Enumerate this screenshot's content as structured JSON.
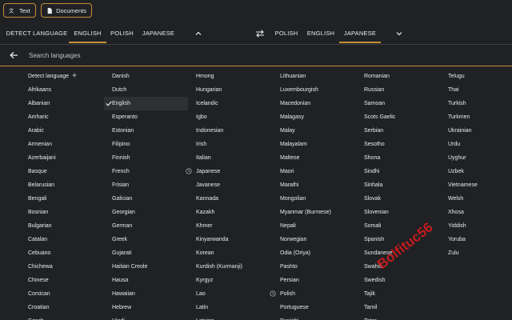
{
  "top_buttons": {
    "text": "Text",
    "documents": "Documents"
  },
  "source_tabs": [
    "DETECT LANGUAGE",
    "ENGLISH",
    "POLISH",
    "JAPANESE"
  ],
  "target_tabs": [
    "POLISH",
    "ENGLISH",
    "JAPANESE"
  ],
  "search": {
    "placeholder": "Search languages"
  },
  "columns": [
    [
      "Detect language",
      "Afrikaans",
      "Albanian",
      "Amharic",
      "Arabic",
      "Armenian",
      "Azerbaijani",
      "Basque",
      "Belarusian",
      "Bengali",
      "Bosnian",
      "Bulgarian",
      "Catalan",
      "Cebuano",
      "Chichewa",
      "Chinese",
      "Corsican",
      "Croatian",
      "Czech"
    ],
    [
      "Danish",
      "Dutch",
      "English",
      "Esperanto",
      "Estonian",
      "Filipino",
      "Finnish",
      "French",
      "Frisian",
      "Galician",
      "Georgian",
      "German",
      "Greek",
      "Gujarati",
      "Haitian Creole",
      "Hausa",
      "Hawaiian",
      "Hebrew",
      "Hindi"
    ],
    [
      "Hmong",
      "Hungarian",
      "Icelandic",
      "Igbo",
      "Indonesian",
      "Irish",
      "Italian",
      "Japanese",
      "Javanese",
      "Kannada",
      "Kazakh",
      "Khmer",
      "Kinyarwanda",
      "Korean",
      "Kurdish (Kurmanji)",
      "Kyrgyz",
      "Lao",
      "Latin",
      "Latvian"
    ],
    [
      "Lithuanian",
      "Luxembourgish",
      "Macedonian",
      "Malagasy",
      "Malay",
      "Malayalam",
      "Maltese",
      "Maori",
      "Marathi",
      "Mongolian",
      "Myanmar (Burmese)",
      "Nepali",
      "Norwegian",
      "Odia (Oriya)",
      "Pashto",
      "Persian",
      "Polish",
      "Portuguese",
      "Punjabi"
    ],
    [
      "Romanian",
      "Russian",
      "Samoan",
      "Scots Gaelic",
      "Serbian",
      "Sesotho",
      "Shona",
      "Sindhi",
      "Sinhala",
      "Slovak",
      "Slovenian",
      "Somali",
      "Spanish",
      "Sundanese",
      "Swahili",
      "Swedish",
      "Tajik",
      "Tamil",
      "Tatar"
    ],
    [
      "Telugu",
      "Thai",
      "Turkish",
      "Turkmen",
      "Ukrainian",
      "Urdu",
      "Uyghur",
      "Uzbek",
      "Vietnamese",
      "Welsh",
      "Xhosa",
      "Yiddish",
      "Yoruba",
      "Zulu"
    ]
  ],
  "selected_language": "English",
  "recent_languages": [
    "Japanese",
    "Polish"
  ],
  "watermark": "Bolfituc56",
  "colors": {
    "accent": "#c58f3a",
    "background": "#202124",
    "text": "#e8eaed"
  },
  "icons": {
    "text": "translate-icon",
    "documents": "document-icon",
    "swap": "swap-arrows-icon",
    "back": "arrow-back-icon",
    "selected": "check-icon",
    "recent": "history-icon",
    "detect": "sparkle-icon"
  }
}
